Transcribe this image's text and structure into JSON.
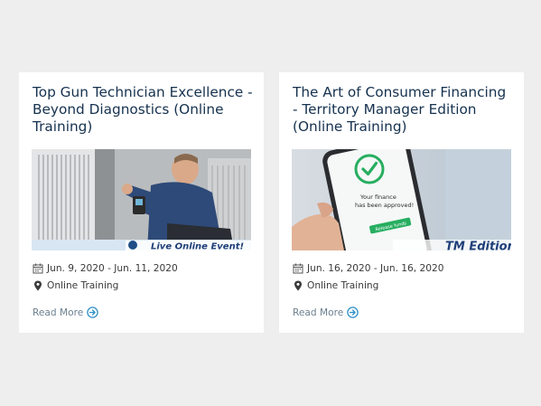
{
  "cards": [
    {
      "title": "Top Gun Technician Excellence - Beyond Diagnostics (Online Training)",
      "image_caption": "Live Online Event!",
      "date": "Jun. 9, 2020 - Jun. 11, 2020",
      "location": "Online Training",
      "read_more": "Read More"
    },
    {
      "title": "The Art of Consumer Financing - Territory Manager Edition (Online Training)",
      "image_caption": "TM Edition",
      "phone_text_1": "Your finance",
      "phone_text_2": "has been approved!",
      "phone_button": "Release funds",
      "date": "Jun. 16, 2020 - Jun. 16, 2020",
      "location": "Online Training",
      "read_more": "Read More"
    }
  ],
  "colors": {
    "page_bg": "#eeeeee",
    "card_bg": "#ffffff",
    "title": "#16324f",
    "meta_text": "#3a3a3a",
    "link": "#6b7f8f",
    "link_icon": "#2f8fc7",
    "success_green": "#27ae60"
  },
  "icons": {
    "date": "calendar-icon",
    "location": "map-pin-icon",
    "read_more": "arrow-circle-right-icon"
  }
}
